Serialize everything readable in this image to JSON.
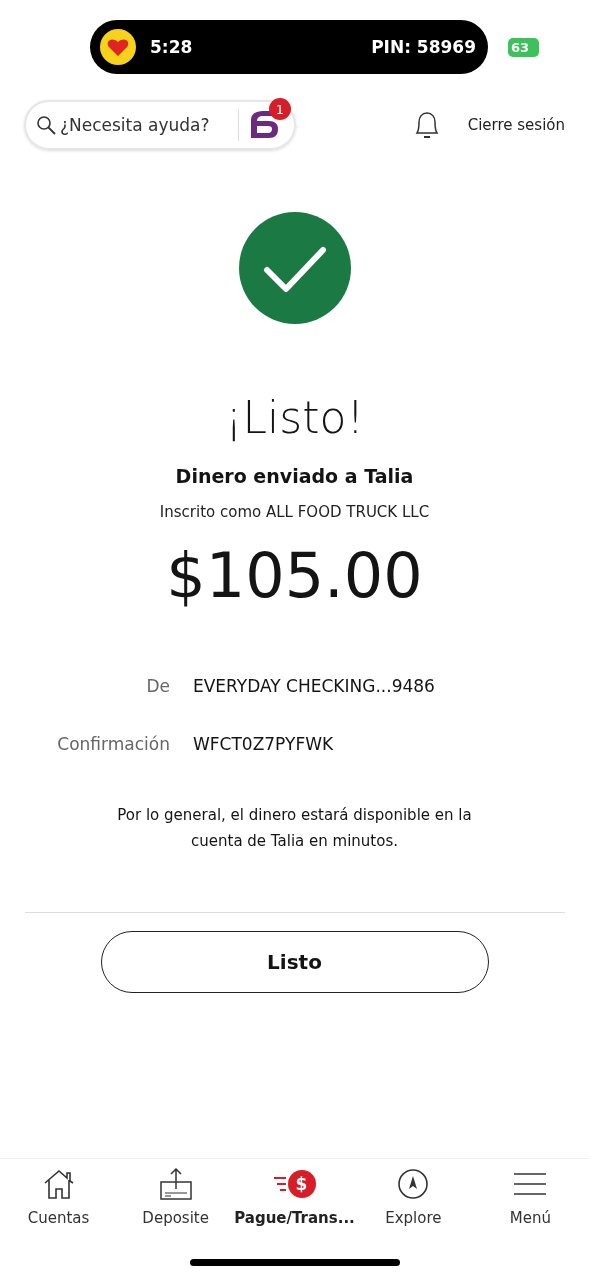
{
  "status_bar": {
    "time": "5:28",
    "pin": "PIN: 58969",
    "battery": "63"
  },
  "header": {
    "search": {
      "placeholder": "¿Necesita ayuda?"
    },
    "chat_badge": "1",
    "logout": "Cierre sesión"
  },
  "result": {
    "title": "¡Listo!",
    "heading": "Dinero enviado a Talia",
    "subheading": "Inscrito como ALL FOOD TRUCK LLC",
    "amount": "$105.00",
    "details": [
      {
        "label": "De",
        "value": "EVERYDAY CHECKING...9486"
      },
      {
        "label": "Confirmación",
        "value": "WFCT0Z7PYFWK"
      }
    ],
    "note": "Por lo general, el dinero estará disponible en la cuenta de Talia en minutos."
  },
  "done_button": "Listo",
  "nav": [
    {
      "kind": "home",
      "label": "Cuentas",
      "selected": false
    },
    {
      "kind": "deposit",
      "label": "Deposite",
      "selected": false
    },
    {
      "kind": "pay",
      "label": "Pague/Trans...",
      "selected": true,
      "glyph": "$"
    },
    {
      "kind": "explore",
      "label": "Explore",
      "selected": false
    },
    {
      "kind": "menu",
      "label": "Menú",
      "selected": false
    }
  ]
}
